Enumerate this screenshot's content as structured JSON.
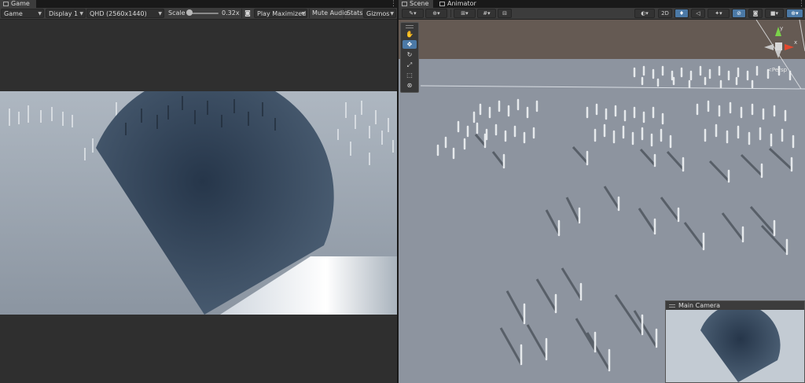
{
  "game": {
    "tab_label": "Game",
    "toolbar": {
      "mode": "Game",
      "display": "Display 1",
      "resolution": "QHD (2560x1440)",
      "scale_label": "Scale",
      "scale_value": "0.32x",
      "play_mode": "Play Maximized",
      "mute_audio": "Mute Audio",
      "stats": "Stats",
      "gizmos": "Gizmos"
    }
  },
  "scene": {
    "tabs": [
      {
        "label": "Scene"
      },
      {
        "label": "Animator"
      }
    ],
    "toolbar": {
      "mode_2d": "2D"
    },
    "gizmo": {
      "axis_y": "y",
      "axis_x": "x",
      "persp_label": "<Persp"
    },
    "tools": [
      "hand-tool",
      "move-tool",
      "rotate-tool",
      "scale-tool",
      "rect-tool",
      "transform-tool"
    ],
    "camera_preview": {
      "title": "Main Camera"
    }
  },
  "colors": {
    "sky_game": "#aeb7c1",
    "ground_game": "#8b95a1",
    "disc": "#3e4f62",
    "scene_ground": "#8d949f",
    "scene_sky": "#655a53",
    "accent": "#4b79a6"
  }
}
